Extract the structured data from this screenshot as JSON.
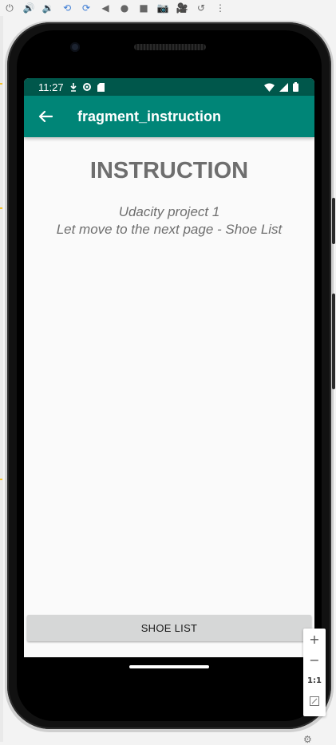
{
  "emulator_toolbar": {
    "icons": [
      "power-icon",
      "volume-up-icon",
      "volume-down-icon",
      "rotate-left-icon",
      "rotate-right-icon",
      "back-icon",
      "home-icon",
      "overview-icon",
      "camera-icon",
      "video-icon",
      "snapshot-icon",
      "more-icon"
    ],
    "glyphs": {
      "power": "⏻",
      "volume_up": "🔊",
      "volume_down": "🔉",
      "rotate_left": "⟲",
      "rotate_right": "⟳",
      "back": "◀",
      "home": "●",
      "overview": "■",
      "camera": "📷",
      "video": "🎥",
      "snapshot": "↺",
      "more": "⋮"
    }
  },
  "status_bar": {
    "time": "11:27",
    "color": "#00574b"
  },
  "app_bar": {
    "title": "fragment_instruction",
    "color": "#008577",
    "back_glyph": "←"
  },
  "content": {
    "heading": "INSTRUCTION",
    "line1": "Udacity project 1",
    "line2": "Let move to the next page - Shoe List"
  },
  "button": {
    "label": "SHOE LIST"
  },
  "zoom_controls": {
    "zoom_in": "+",
    "zoom_out": "−",
    "actual_size": "1:1"
  }
}
